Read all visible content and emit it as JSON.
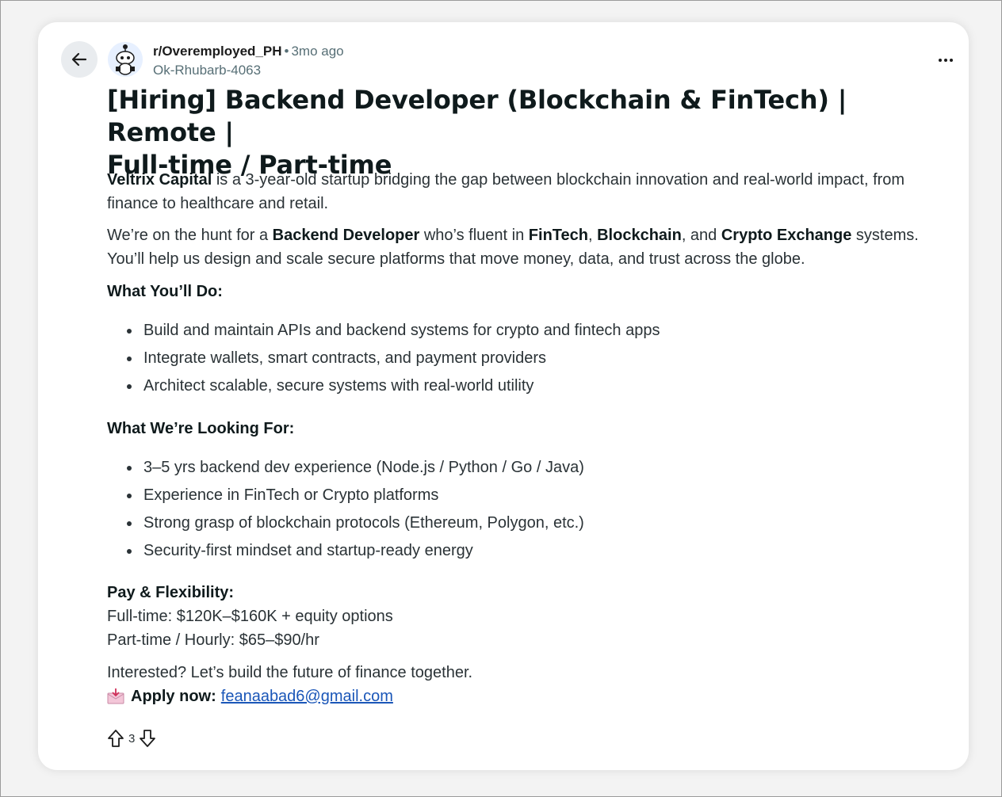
{
  "post": {
    "subreddit": "r/Overemployed_PH",
    "separator": "•",
    "time_ago": "3mo ago",
    "author": "Ok-Rhubarb-4063",
    "title_line1": "[Hiring] Backend Developer (Blockchain & FinTech) | Remote |",
    "title_line2": "Full-time / Part-time",
    "intro": {
      "company": "Veltrix Capital",
      "rest": " is a 3-year-old startup bridging the gap between blockchain innovation and real-world impact, from finance to healthcare and retail."
    },
    "hunt": {
      "p1": "We’re on the hunt for a ",
      "b1": "Backend Developer",
      "p2": " who’s fluent in ",
      "b2": "FinTech",
      "p3": ", ",
      "b3": "Blockchain",
      "p4": ", and ",
      "b4": "Crypto Exchange",
      "p5": " systems. You’ll help us design and scale secure platforms that move money, data, and trust across the globe."
    },
    "section_do": {
      "heading": "What You’ll Do:",
      "items": [
        "Build and maintain APIs and backend systems for crypto and fintech apps",
        "Integrate wallets, smart contracts, and payment providers",
        "Architect scalable, secure systems with real-world utility"
      ]
    },
    "section_looking": {
      "heading": "What We’re Looking For:",
      "items": [
        "3–5 yrs backend dev experience (Node.js / Python / Go / Java)",
        "Experience in FinTech or Crypto platforms",
        "Strong grasp of blockchain protocols (Ethereum, Polygon, etc.)",
        "Security-first mindset and startup-ready energy"
      ]
    },
    "pay": {
      "heading": "Pay & Flexibility:",
      "full_time": "Full-time: $120K–$160K + equity options",
      "part_time": "Part-time / Hourly: $65–$90/hr"
    },
    "closing": "Interested? Let’s build the future of finance together.",
    "apply_label": "Apply now:",
    "apply_email": "feanaabad6@gmail.com",
    "vote_count": "3"
  },
  "icons": {
    "back": "arrow-left-icon",
    "avatar": "reddit-snoo-avatar",
    "more": "more-horizontal-icon",
    "envelope": "incoming-envelope-icon",
    "upvote": "upvote-arrow-icon",
    "downvote": "downvote-arrow-icon"
  },
  "colors": {
    "link": "#1a56b8",
    "meta_gray": "#576f76",
    "back_button_bg": "#e9ecef"
  }
}
